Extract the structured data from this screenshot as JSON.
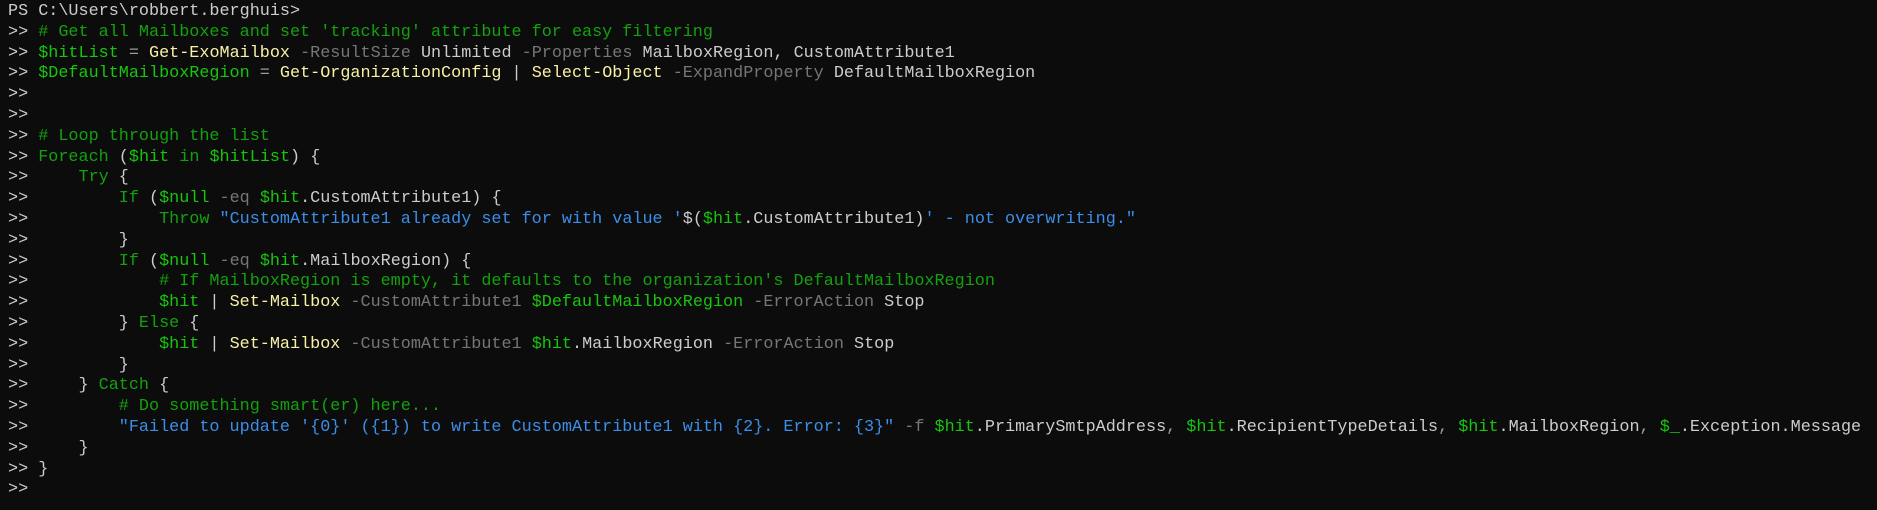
{
  "terminal": {
    "colors": {
      "background": "#0c0c0c",
      "plain": "#cccccc",
      "comment": "#13a10e",
      "variable": "#16c60c",
      "keyword": "#13a10e",
      "cmdlet": "#f9f1a5",
      "parameter": "#767676",
      "operator": "#9a9a9a",
      "string": "#3b8eea"
    },
    "lines": [
      [
        [
          "PS C:\\Users\\robbert.berghuis>",
          "p"
        ]
      ],
      [
        [
          ">> ",
          "p"
        ],
        [
          "# Get all Mailboxes and set 'tracking' attribute for easy filtering",
          "c"
        ]
      ],
      [
        [
          ">> ",
          "p"
        ],
        [
          "$hitList",
          "v"
        ],
        [
          " = ",
          "o"
        ],
        [
          "Get-ExoMailbox",
          "m"
        ],
        [
          " -ResultSize",
          "a"
        ],
        [
          " Unlimited",
          "p"
        ],
        [
          " -Properties",
          "a"
        ],
        [
          " MailboxRegion, CustomAttribute1",
          "p"
        ]
      ],
      [
        [
          ">> ",
          "p"
        ],
        [
          "$DefaultMailboxRegion",
          "v"
        ],
        [
          " = ",
          "o"
        ],
        [
          "Get-OrganizationConfig",
          "m"
        ],
        [
          " | ",
          "p"
        ],
        [
          "Select-Object",
          "m"
        ],
        [
          " -ExpandProperty",
          "a"
        ],
        [
          " DefaultMailboxRegion",
          "p"
        ]
      ],
      [
        [
          ">>",
          "p"
        ]
      ],
      [
        [
          ">>",
          "p"
        ]
      ],
      [
        [
          ">> ",
          "p"
        ],
        [
          "# Loop through the list",
          "c"
        ]
      ],
      [
        [
          ">> ",
          "p"
        ],
        [
          "Foreach",
          "k"
        ],
        [
          " (",
          "p"
        ],
        [
          "$hit",
          "v"
        ],
        [
          " in ",
          "k"
        ],
        [
          "$hitList",
          "v"
        ],
        [
          ") {",
          "p"
        ]
      ],
      [
        [
          ">>     ",
          "p"
        ],
        [
          "Try",
          "k"
        ],
        [
          " {",
          "p"
        ]
      ],
      [
        [
          ">>         ",
          "p"
        ],
        [
          "If",
          "k"
        ],
        [
          " (",
          "p"
        ],
        [
          "$null",
          "v"
        ],
        [
          " -eq ",
          "a"
        ],
        [
          "$hit",
          "v"
        ],
        [
          ".CustomAttribute1) {",
          "p"
        ]
      ],
      [
        [
          ">>             ",
          "p"
        ],
        [
          "Throw",
          "k"
        ],
        [
          " ",
          "p"
        ],
        [
          "\"CustomAttribute1 already set for with value '",
          "s"
        ],
        [
          "$(",
          "p"
        ],
        [
          "$hit",
          "v"
        ],
        [
          ".CustomAttribute1)",
          "p"
        ],
        [
          "' - not overwriting.\"",
          "s"
        ]
      ],
      [
        [
          ">>         }",
          "p"
        ]
      ],
      [
        [
          ">>         ",
          "p"
        ],
        [
          "If",
          "k"
        ],
        [
          " (",
          "p"
        ],
        [
          "$null",
          "v"
        ],
        [
          " -eq ",
          "a"
        ],
        [
          "$hit",
          "v"
        ],
        [
          ".MailboxRegion) {",
          "p"
        ]
      ],
      [
        [
          ">>             ",
          "p"
        ],
        [
          "# If MailboxRegion is empty, it defaults to the organization's DefaultMailboxRegion",
          "c"
        ]
      ],
      [
        [
          ">>             ",
          "p"
        ],
        [
          "$hit",
          "v"
        ],
        [
          " | ",
          "p"
        ],
        [
          "Set-Mailbox",
          "m"
        ],
        [
          " -CustomAttribute1 ",
          "a"
        ],
        [
          "$DefaultMailboxRegion",
          "v"
        ],
        [
          " -ErrorAction",
          "a"
        ],
        [
          " Stop",
          "p"
        ]
      ],
      [
        [
          ">>         } ",
          "p"
        ],
        [
          "Else",
          "k"
        ],
        [
          " {",
          "p"
        ]
      ],
      [
        [
          ">>             ",
          "p"
        ],
        [
          "$hit",
          "v"
        ],
        [
          " | ",
          "p"
        ],
        [
          "Set-Mailbox",
          "m"
        ],
        [
          " -CustomAttribute1 ",
          "a"
        ],
        [
          "$hit",
          "v"
        ],
        [
          ".MailboxRegion",
          "p"
        ],
        [
          " -ErrorAction",
          "a"
        ],
        [
          " Stop",
          "p"
        ]
      ],
      [
        [
          ">>         }",
          "p"
        ]
      ],
      [
        [
          ">>     } ",
          "p"
        ],
        [
          "Catch",
          "k"
        ],
        [
          " {",
          "p"
        ]
      ],
      [
        [
          ">>         ",
          "p"
        ],
        [
          "# Do something smart(er) here...",
          "c"
        ]
      ],
      [
        [
          ">>         ",
          "p"
        ],
        [
          "\"Failed to update '{0}' ({1}) to write CustomAttribute1 with {2}. Error: {3}\"",
          "s"
        ],
        [
          " -f ",
          "a"
        ],
        [
          "$hit",
          "v"
        ],
        [
          ".PrimarySmtpAddress",
          "p"
        ],
        [
          ", ",
          "o"
        ],
        [
          "$hit",
          "v"
        ],
        [
          ".RecipientTypeDetails",
          "p"
        ],
        [
          ", ",
          "o"
        ],
        [
          "$hit",
          "v"
        ],
        [
          ".MailboxRegion",
          "p"
        ],
        [
          ", ",
          "o"
        ],
        [
          "$_",
          "v"
        ],
        [
          ".Exception.Message",
          "p"
        ]
      ],
      [
        [
          ">>     }",
          "p"
        ]
      ],
      [
        [
          ">> }",
          "p"
        ]
      ],
      [
        [
          ">>",
          "p"
        ]
      ]
    ]
  }
}
